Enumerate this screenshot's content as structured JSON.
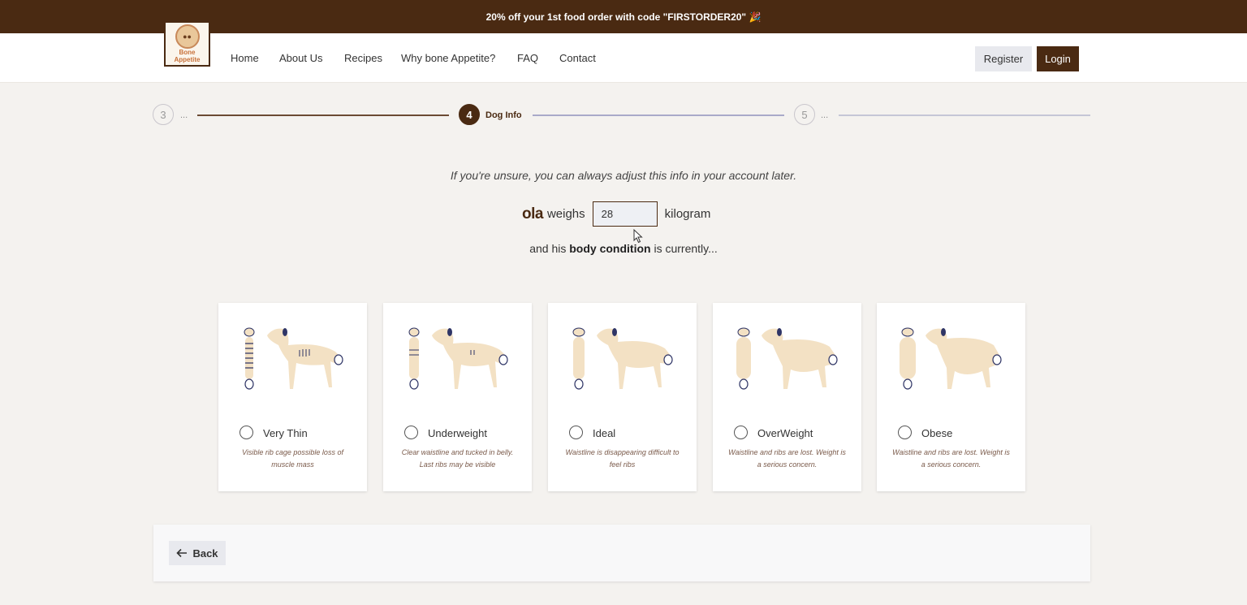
{
  "promo": {
    "text": "20% off your 1st food order with code \"FIRSTORDER20\" 🎉"
  },
  "logo": {
    "text_line1": "Bone",
    "text_line2": "Appetite"
  },
  "nav": {
    "links": [
      "Home",
      "About Us",
      "Recipes",
      "Why bone Appetite?",
      "FAQ",
      "Contact"
    ],
    "register_label": "Register",
    "login_label": "Login"
  },
  "stepper": {
    "prev": {
      "number": "3",
      "label": "..."
    },
    "current": {
      "number": "4",
      "label": "Dog Info"
    },
    "next": {
      "number": "5",
      "label": "..."
    }
  },
  "form": {
    "hint": "If you're unsure, you can always adjust this info in your account later.",
    "dog_name": "ola",
    "weighs_label": "weighs",
    "weight_value": "28",
    "unit": "kilogram",
    "condition_prefix": "and his",
    "condition_bold": "body condition",
    "condition_suffix": "is currently..."
  },
  "conditions": [
    {
      "title": "Very Thin",
      "desc": "Visible rib cage possible loss of muscle mass"
    },
    {
      "title": "Underweight",
      "desc": "Clear waistline and tucked in belly. Last ribs may be visible"
    },
    {
      "title": "Ideal",
      "desc": "Waistline is disappearing difficult to feel ribs"
    },
    {
      "title": "OverWeight",
      "desc": "Waistline and ribs are lost. Weight is a serious concern."
    },
    {
      "title": "Obese",
      "desc": "Waistline and ribs are lost. Weight is a serious concern."
    }
  ],
  "footer": {
    "back_label": "Back"
  },
  "colors": {
    "brand": "#4a2a12",
    "dog_fill": "#f3e1c4",
    "dog_accent": "#2f3566"
  }
}
